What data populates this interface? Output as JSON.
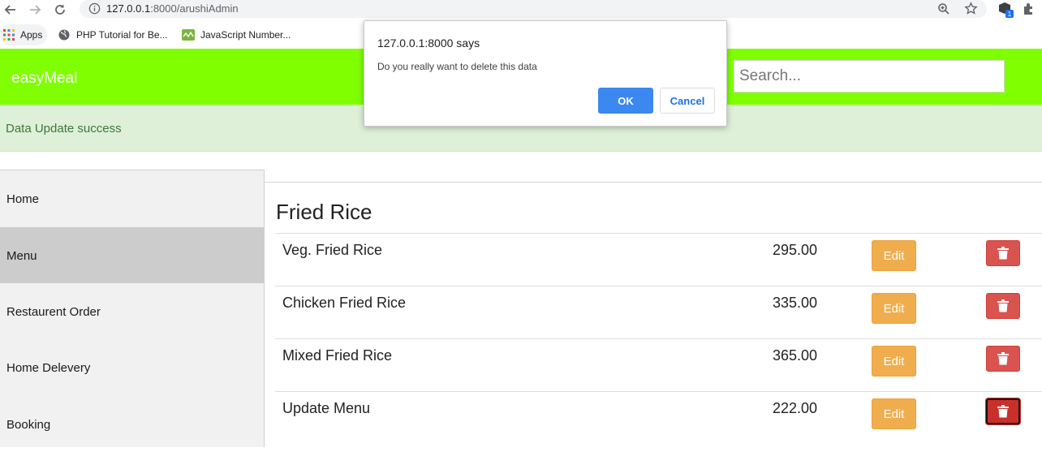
{
  "browser": {
    "url_host": "127.0.0.1",
    "url_rest": ":8000/arushiAdmin",
    "bookmarks": [
      {
        "label": "Apps",
        "icon": "apps-grid-icon"
      },
      {
        "label": "PHP Tutorial for Be...",
        "icon": "globe-icon"
      },
      {
        "label": "JavaScript Number...",
        "icon": "site-favicon-icon"
      }
    ],
    "extension_badge": "1"
  },
  "header": {
    "brand": "easyMeal",
    "search_placeholder": "Search..."
  },
  "alert": {
    "message": "Data Update success"
  },
  "sidebar": {
    "items": [
      {
        "label": "Home",
        "active": false
      },
      {
        "label": "Menu",
        "active": true
      },
      {
        "label": "Restaurent Order",
        "active": false
      },
      {
        "label": "Home Delevery",
        "active": false
      },
      {
        "label": "Booking",
        "active": false
      }
    ]
  },
  "main": {
    "category_title": "Fried Rice",
    "edit_label": "Edit",
    "items": [
      {
        "name": "Veg. Fried Rice",
        "price": "295.00"
      },
      {
        "name": "Chicken Fried Rice",
        "price": "335.00"
      },
      {
        "name": "Mixed Fried Rice",
        "price": "365.00"
      },
      {
        "name": "Update Menu",
        "price": "222.00"
      }
    ]
  },
  "dialog": {
    "title": "127.0.0.1:8000 says",
    "message": "Do you really want to delete this data",
    "ok_label": "OK",
    "cancel_label": "Cancel"
  },
  "colors": {
    "header_bg": "#7fff00",
    "alert_bg": "#dff0d8",
    "alert_text": "#3c763d",
    "edit_button": "#f0ad4e",
    "delete_button": "#d9534f",
    "dialog_ok": "#3b88f0"
  }
}
